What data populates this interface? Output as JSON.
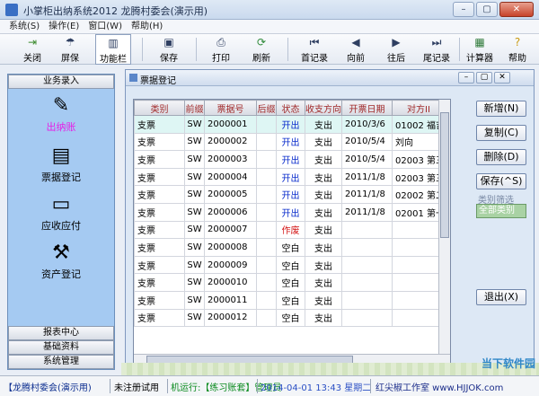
{
  "window": {
    "title": "小掌柜出纳系统2012  龙腾村委会(演示用)",
    "min": "–",
    "max": "▢",
    "close": "✕"
  },
  "menu": [
    "系统(S)",
    "操作(E)",
    "窗口(W)",
    "帮助(H)"
  ],
  "toolbar": [
    {
      "label": "关闭",
      "icon": "exit-icon",
      "glyph": "⇥"
    },
    {
      "label": "屏保",
      "icon": "umbrella-icon",
      "glyph": "☂"
    },
    {
      "label": "功能栏",
      "icon": "function-bar-icon",
      "glyph": "▥"
    },
    {
      "label": "保存",
      "icon": "save-icon",
      "glyph": "▣"
    },
    {
      "label": "打印",
      "icon": "print-icon",
      "glyph": "⎙"
    },
    {
      "label": "刷新",
      "icon": "refresh-icon",
      "glyph": "⟳"
    },
    {
      "label": "首记录",
      "icon": "first-record-icon",
      "glyph": "⏮"
    },
    {
      "label": "向前",
      "icon": "previous-icon",
      "glyph": "◀"
    },
    {
      "label": "往后",
      "icon": "next-icon",
      "glyph": "▶"
    },
    {
      "label": "尾记录",
      "icon": "last-record-icon",
      "glyph": "⏭"
    },
    {
      "label": "计算器",
      "icon": "calculator-icon",
      "glyph": "▦"
    },
    {
      "label": "帮助",
      "icon": "help-icon",
      "glyph": "?"
    }
  ],
  "left_panel": {
    "header": "业务录入",
    "items": [
      {
        "label": "出纳账",
        "icon": "cashbook-icon",
        "glyph": "✎"
      },
      {
        "label": "票据登记",
        "icon": "receipt-register-icon",
        "glyph": "▤"
      },
      {
        "label": "应收应付",
        "icon": "receivable-payable-icon",
        "glyph": "▭"
      },
      {
        "label": "资产登记",
        "icon": "asset-register-icon",
        "glyph": "⚒"
      }
    ],
    "footer": [
      "报表中心",
      "基础资料",
      "系统管理"
    ]
  },
  "child_window": {
    "title": "票据登记",
    "columns": [
      "类别",
      "前缀",
      "票据号",
      "后缀",
      "状态",
      "收支方向",
      "开票日期",
      "对方II"
    ],
    "rows": [
      {
        "cat": "支票",
        "prefix": "SW",
        "no": "2000001",
        "suffix": "",
        "status": "开出",
        "dir": "支出",
        "date": "2010/3/6",
        "party": "01002 福吉"
      },
      {
        "cat": "支票",
        "prefix": "SW",
        "no": "2000002",
        "suffix": "",
        "status": "开出",
        "dir": "支出",
        "date": "2010/5/4",
        "party": "刘向"
      },
      {
        "cat": "支票",
        "prefix": "SW",
        "no": "2000003",
        "suffix": "",
        "status": "开出",
        "dir": "支出",
        "date": "2010/5/4",
        "party": "02003 第三"
      },
      {
        "cat": "支票",
        "prefix": "SW",
        "no": "2000004",
        "suffix": "",
        "status": "开出",
        "dir": "支出",
        "date": "2011/1/8",
        "party": "02003 第三"
      },
      {
        "cat": "支票",
        "prefix": "SW",
        "no": "2000005",
        "suffix": "",
        "status": "开出",
        "dir": "支出",
        "date": "2011/1/8",
        "party": "02002 第二"
      },
      {
        "cat": "支票",
        "prefix": "SW",
        "no": "2000006",
        "suffix": "",
        "status": "开出",
        "dir": "支出",
        "date": "2011/1/8",
        "party": "02001 第一"
      },
      {
        "cat": "支票",
        "prefix": "SW",
        "no": "2000007",
        "suffix": "",
        "status": "作废",
        "dir": "支出",
        "date": "",
        "party": ""
      },
      {
        "cat": "支票",
        "prefix": "SW",
        "no": "2000008",
        "suffix": "",
        "status": "空白",
        "dir": "支出",
        "date": "",
        "party": ""
      },
      {
        "cat": "支票",
        "prefix": "SW",
        "no": "2000009",
        "suffix": "",
        "status": "空白",
        "dir": "支出",
        "date": "",
        "party": ""
      },
      {
        "cat": "支票",
        "prefix": "SW",
        "no": "2000010",
        "suffix": "",
        "status": "空白",
        "dir": "支出",
        "date": "",
        "party": ""
      },
      {
        "cat": "支票",
        "prefix": "SW",
        "no": "2000011",
        "suffix": "",
        "status": "空白",
        "dir": "支出",
        "date": "",
        "party": ""
      },
      {
        "cat": "支票",
        "prefix": "SW",
        "no": "2000012",
        "suffix": "",
        "status": "空白",
        "dir": "支出",
        "date": "",
        "party": ""
      }
    ],
    "buttons": {
      "add": "新增(N)",
      "copy": "复制(C)",
      "delete": "删除(D)",
      "save": "保存(^S)",
      "exit": "退出(X)"
    },
    "filter": {
      "legend": "类别筛选",
      "value": "全部类别"
    }
  },
  "statusbar": {
    "company": "【龙腾村委会(演示用)",
    "reg": "未注册试用",
    "run": "机运行:【练习账套】管理员",
    "time": "2014-04-01 13:43 星期二",
    "studio": "红尖椒工作室 www.HJJOK.com"
  },
  "watermark": "当下软件园"
}
